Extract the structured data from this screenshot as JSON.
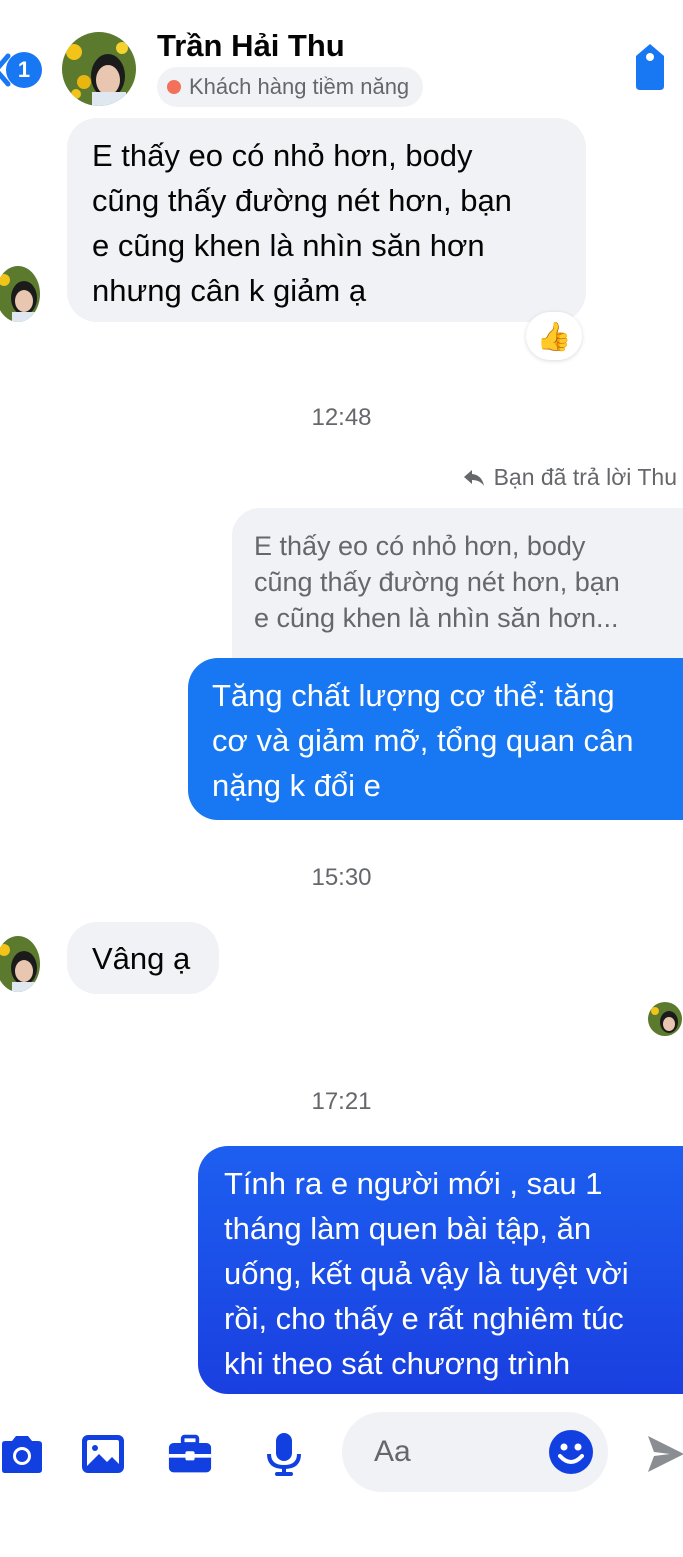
{
  "header": {
    "unread_count": "1",
    "contact_name": "Trần Hải Thu",
    "status_label": "Khách hàng tiềm năng",
    "status_color": "#f3705a",
    "accent_color": "#1877f2",
    "tag_icon": "tag-icon"
  },
  "messages": {
    "msg1_lines": [
      "E thấy eo có nhỏ hơn, body",
      "cũng thấy đường nét hơn, bạn",
      "e cũng khen là nhìn săn hơn",
      "nhưng cân k giảm ạ"
    ],
    "msg1_reaction": "👍",
    "time1": "12:48",
    "reply_label": "Bạn đã trả lời Thu",
    "quote_lines": [
      "E thấy eo có nhỏ hơn, body",
      "cũng thấy đường nét hơn, bạn",
      "e cũng khen là nhìn săn hơn..."
    ],
    "msg2_lines": [
      "Tăng chất lượng cơ thể: tăng",
      "cơ và giảm mỡ, tổng quan cân",
      "nặng k đổi e"
    ],
    "time2": "15:30",
    "msg3_text": "Vâng ạ",
    "time3": "17:21",
    "msg4_lines": [
      "Tính ra e người mới , sau 1",
      "tháng làm quen bài tập, ăn",
      "uống, kết quả vậy là tuyệt vời",
      "rồi, cho thấy e rất nghiêm túc",
      "khi theo sát chương trình"
    ]
  },
  "composer": {
    "placeholder": "Aa",
    "icons": [
      "camera-icon",
      "image-icon",
      "toolbox-icon",
      "microphone-icon",
      "emoji-icon",
      "send-icon"
    ]
  },
  "colors": {
    "outgoing_top": "#1877f2",
    "outgoing_bottom": "#1a3fe0",
    "incoming_bg": "#f0f2f5"
  }
}
